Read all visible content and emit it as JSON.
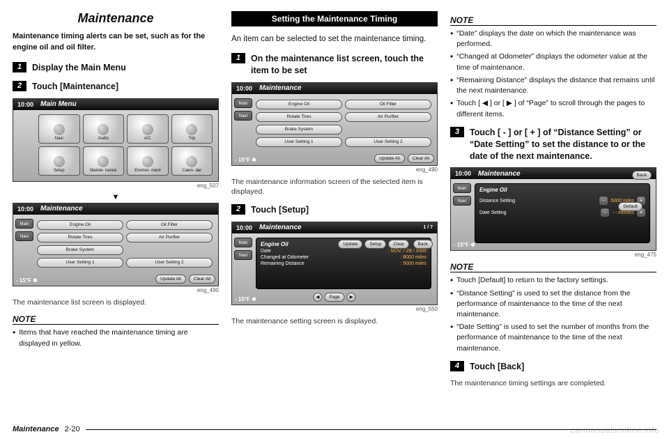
{
  "col1": {
    "title": "Maintenance",
    "intro": "Maintenance timing alerts can be set, such as for the engine oil and oil filter.",
    "step1": {
      "num": "1",
      "text": "Display the Main Menu"
    },
    "step2": {
      "num": "2",
      "text": "Touch [Maintenance]"
    },
    "imgcap1": "eng_507",
    "arrow": "▼",
    "imgcap2": "eng_490",
    "after_list": "The maintenance list screen is displayed.",
    "note_head": "NOTE",
    "note_items": [
      "Items that have reached the maintenance timing are displayed in yellow."
    ],
    "mainmenu": {
      "time": "10:00",
      "title": "Main Menu",
      "cells": [
        "Navi",
        "Audio",
        "A/C",
        "Trip",
        "Setup",
        "Mainte-\nnance",
        "Environ-\nment",
        "Calen-\ndar"
      ]
    },
    "mlist": {
      "time": "10:00",
      "title": "Maintenance",
      "side": [
        "Main",
        "Navi"
      ],
      "items": [
        "Engine Oil",
        "Oil Filter",
        "Rotate Tires",
        "Air Purifier",
        "Brake System",
        "",
        "User Setting 1",
        "User Setting 2"
      ],
      "bottom": [
        "Update All",
        "Clear All"
      ],
      "temp": "- 15°F ❄"
    }
  },
  "col2": {
    "section_title": "Setting the Maintenance Timing",
    "intro": "An item can be selected to set the maintenance timing.",
    "step1": {
      "num": "1",
      "text": "On the maintenance list screen, touch the item to be set"
    },
    "imgcap1": "eng_490",
    "after1": "The maintenance information screen of the selected item is displayed.",
    "step2": {
      "num": "2",
      "text": "Touch [Setup]"
    },
    "imgcap2": "eng_550",
    "after2": "The maintenance setting screen is displayed.",
    "mdetail": {
      "time": "10:00",
      "title": "Maintenance",
      "side": [
        "Main",
        "Navi"
      ],
      "counter": "1 / 7",
      "back": "Back",
      "topbtns": [
        "Update",
        "Setup",
        "Clear"
      ],
      "panel_title": "Engine Oil",
      "rows": [
        [
          "Date",
          ": NOV. / 28 / 2005"
        ],
        [
          "Changed at Odometer",
          ": 8000 miles"
        ],
        [
          "Remaining Distance",
          ": 5000 miles"
        ]
      ],
      "pager": [
        "◀",
        "Page",
        "▶"
      ],
      "temp": "- 15°F ❄"
    }
  },
  "col3": {
    "note1_head": "NOTE",
    "note1_items": [
      "“Date” displays the date on which the maintenance was performed.",
      "“Changed at Odometer” displays the odometer value at the time of maintenance.",
      "“Remaining Distance” displays the distance that remains until the next maintenance.",
      "Touch [ ◀ ] or [ ▶ ] of “Page” to scroll through the pages to different items."
    ],
    "step3": {
      "num": "3",
      "text": "Touch [ - ] or [ + ] of “Distance Setting” or “Date Setting” to set the distance to or the date of the next maintenance."
    },
    "imgcap": "eng_475",
    "dset": {
      "time": "10:00",
      "title": "Maintenance",
      "side": [
        "Main",
        "Navi"
      ],
      "back": "Back",
      "default": "Default",
      "panel_title": "Engine Oil",
      "rows": [
        {
          "label": "Distance Setting",
          "value": "5000 miles"
        },
        {
          "label": "Date Setting",
          "value": "- - months"
        }
      ],
      "temp": "- 15°F ❄"
    },
    "note2_head": "NOTE",
    "note2_items": [
      "Touch [Default] to return to the factory settings.",
      "“Distance Setting” is used to set the distance from the performance of maintenance to the time of the next maintenance.",
      "“Date Setting” is used to set the number of months from the performance of maintenance to the time of the next maintenance."
    ],
    "step4": {
      "num": "4",
      "text": "Touch [Back]"
    },
    "after4": "The maintenance timing settings are completed."
  },
  "footer": {
    "title": "Maintenance",
    "page": "2-20"
  },
  "watermark": "carmanualsonline.info"
}
